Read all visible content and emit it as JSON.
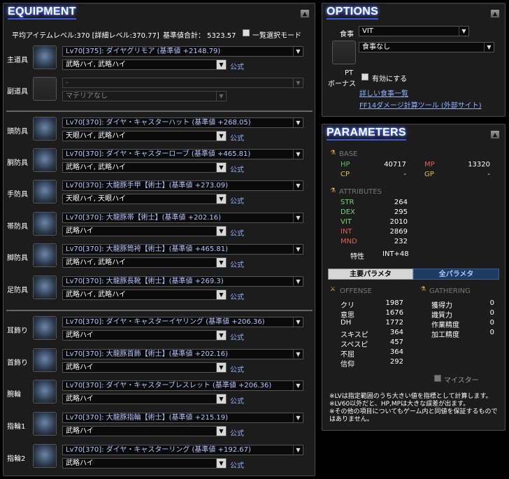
{
  "equipment": {
    "title": "EQUIPMENT",
    "avg_item_level": "平均アイテムレベル:370 [詳細レベル:370.77]",
    "total_base": "基準値合計： 5323.57",
    "select_all_mode": "一覧選択モード",
    "official_label": "公式",
    "slots": [
      {
        "label": "主道具",
        "main": "Lv70[375]: ダイヤグリモア (基準値 +2148.79)",
        "sub": "武略ハイ, 武略ハイ",
        "icon": "grimoire-icon",
        "has_official": true
      },
      {
        "label": "副道具",
        "main": "-",
        "sub": "マテリアなし",
        "icon": "empty-slot-icon",
        "has_official": false
      },
      {
        "label": "頭防具",
        "main": "Lv70[370]: ダイヤ・キャスターハット (基準値 +268.05)",
        "sub": "天眼ハイ, 武略ハイ",
        "icon": "hat-icon",
        "has_official": true
      },
      {
        "label": "胴防具",
        "main": "Lv70[370]: ダイヤ・キャスターローブ (基準値 +465.81)",
        "sub": "武略ハイ, 武略ハイ",
        "icon": "robe-icon",
        "has_official": true
      },
      {
        "label": "手防具",
        "main": "Lv70[370]: 大龍豚手甲【術士】(基準値 +273.09)",
        "sub": "天眼ハイ, 天眼ハイ",
        "icon": "gloves-icon",
        "has_official": true
      },
      {
        "label": "帯防具",
        "main": "Lv70[370]: 大龍豚帯【術士】(基準値 +202.16)",
        "sub": "武略ハイ",
        "icon": "belt-icon",
        "has_official": true
      },
      {
        "label": "脚防具",
        "main": "Lv70[370]: 大龍豚筒袴【術士】(基準値 +465.81)",
        "sub": "武略ハイ, 武略ハイ",
        "icon": "legs-icon",
        "has_official": true
      },
      {
        "label": "足防具",
        "main": "Lv70[370]: 大龍豚長靴【術士】(基準値 +269.3)",
        "sub": "武略ハイ, 武略ハイ",
        "icon": "boots-icon",
        "has_official": true
      },
      {
        "label": "耳飾り",
        "main": "Lv70[370]: ダイヤ・キャスターイヤリング (基準値 +206.36)",
        "sub": "武略ハイ",
        "icon": "earring-icon",
        "has_official": true
      },
      {
        "label": "首飾り",
        "main": "Lv70[370]: 大龍豚首飾【術士】(基準値 +202.16)",
        "sub": "武略ハイ",
        "icon": "necklace-icon",
        "has_official": true
      },
      {
        "label": "腕輪",
        "main": "Lv70[370]: ダイヤ・キャスターブレスレット (基準値 +206.36)",
        "sub": "武略ハイ",
        "icon": "bracelet-icon",
        "has_official": true
      },
      {
        "label": "指輪1",
        "main": "Lv70[370]: 大龍豚指輪【術士】(基準値 +215.19)",
        "sub": "武略ハイ",
        "icon": "ring-icon",
        "has_official": true
      },
      {
        "label": "指輪2",
        "main": "Lv70[370]: ダイヤ・キャスターリング (基準値 +192.67)",
        "sub": "武略ハイ",
        "icon": "ring-icon",
        "has_official": true
      }
    ]
  },
  "options": {
    "title": "OPTIONS",
    "food_label": "食事",
    "food_stat": "VIT",
    "food_value": "食事なし",
    "pt_bonus_label_1": "PT",
    "pt_bonus_label_2": "ボーナス",
    "enable_label": "有効にする",
    "food_list_link": "詳しい食事一覧",
    "calc_tool_link": "FF14ダメージ計算ツール (外部サイト)"
  },
  "parameters": {
    "title": "PARAMETERS",
    "base_header": "BASE",
    "hp_label": "HP",
    "hp_value": "40717",
    "mp_label": "MP",
    "mp_value": "13320",
    "cp_label": "CP",
    "cp_value": "-",
    "gp_label": "GP",
    "gp_value": "-",
    "attributes_header": "ATTRIBUTES",
    "attributes": [
      {
        "label": "STR",
        "value": "264"
      },
      {
        "label": "DEX",
        "value": "295"
      },
      {
        "label": "VIT",
        "value": "2010"
      },
      {
        "label": "INT",
        "value": "2869"
      },
      {
        "label": "MND",
        "value": "232"
      }
    ],
    "trait_label": "特性",
    "trait_value": "INT+48",
    "tab_main": "主要パラメタ",
    "tab_all": "全パラメタ",
    "offense_header": "OFFENSE",
    "gathering_header": "GATHERING",
    "offense": [
      {
        "label": "クリ",
        "value": "1987"
      },
      {
        "label": "意思",
        "value": "1676"
      },
      {
        "label": "DH",
        "value": "1772"
      },
      {
        "label": "スキスピ",
        "value": "364"
      },
      {
        "label": "スペスピ",
        "value": "457"
      },
      {
        "label": "不屈",
        "value": "364"
      },
      {
        "label": "信仰",
        "value": "292"
      }
    ],
    "gathering": [
      {
        "label": "獲得力",
        "value": "0"
      },
      {
        "label": "識質力",
        "value": "0"
      },
      {
        "label": "作業精度",
        "value": "0"
      },
      {
        "label": "加工精度",
        "value": "0"
      }
    ],
    "meister_label": "マイスター",
    "note_1": "※LVは指定範囲のうち大きい値を指標として計算します。",
    "note_2": "※LV60以外だと、HP,MPは大きな誤差が出ます。",
    "note_3": "※その他の項目についてもゲーム内と同値を保証するもので",
    "note_4": "はありません。"
  },
  "colors": {
    "panel_bg": "#1c1c1c",
    "title_glow": "#3a5cff",
    "link": "#8fb2ff",
    "main_select_text": "#b9c3ff",
    "hp": "#5cc25c",
    "mp": "#e06060",
    "attr_green": "#78d878"
  }
}
